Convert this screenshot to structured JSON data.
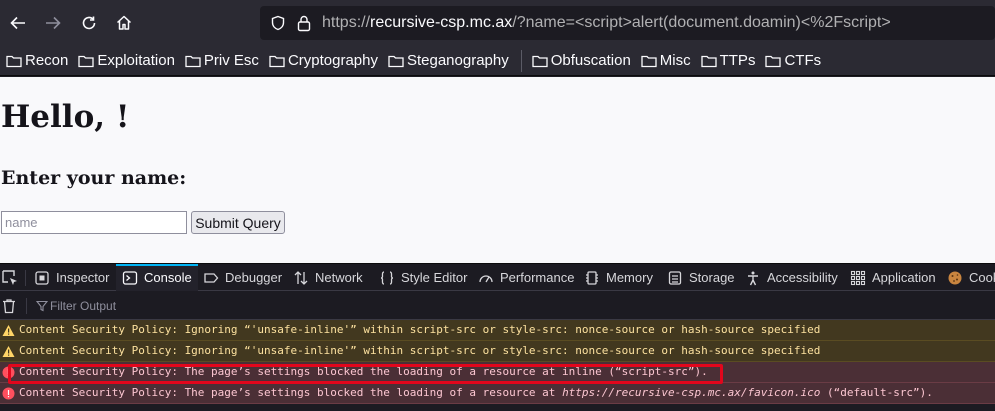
{
  "toolbar": {
    "back_icon": "back-arrow-icon",
    "forward_icon": "forward-arrow-icon",
    "reload_icon": "reload-icon",
    "home_icon": "home-icon",
    "url_prefix": "https://",
    "url_host": "recursive-csp.mc.ax",
    "url_rest": "/?name=<script>alert(document.doamin)<%2Fscript>"
  },
  "bookmarks": {
    "items": [
      {
        "label": "Recon"
      },
      {
        "label": "Exploitation"
      },
      {
        "label": "Priv Esc"
      },
      {
        "label": "Cryptography"
      },
      {
        "label": "Steganography"
      },
      {
        "label": "Obfuscation"
      },
      {
        "label": "Misc"
      },
      {
        "label": "TTPs"
      },
      {
        "label": "CTFs"
      }
    ]
  },
  "page": {
    "heading": "Hello, !",
    "subheading": "Enter your name:",
    "name_placeholder": "name",
    "name_value": "",
    "submit_label": "Submit Query"
  },
  "devtools": {
    "tabs": [
      {
        "label": "Inspector",
        "icon": "inspector-icon"
      },
      {
        "label": "Console",
        "icon": "console-icon",
        "selected": true
      },
      {
        "label": "Debugger",
        "icon": "debugger-icon"
      },
      {
        "label": "Network",
        "icon": "network-icon"
      },
      {
        "label": "Style Editor",
        "icon": "style-editor-icon"
      },
      {
        "label": "Performance",
        "icon": "performance-icon"
      },
      {
        "label": "Memory",
        "icon": "memory-icon"
      },
      {
        "label": "Storage",
        "icon": "storage-icon"
      },
      {
        "label": "Accessibility",
        "icon": "accessibility-icon"
      },
      {
        "label": "Application",
        "icon": "application-icon"
      },
      {
        "label": "Cook",
        "icon": "cookie-icon"
      }
    ],
    "filter_placeholder": "Filter Output",
    "messages": [
      {
        "level": "warning",
        "text": "Content Security Policy: Ignoring “'unsafe-inline'” within script-src or style-src: nonce-source or hash-source specified"
      },
      {
        "level": "warning",
        "text": "Content Security Policy: Ignoring “'unsafe-inline'” within script-src or style-src: nonce-source or hash-source specified"
      },
      {
        "level": "error",
        "text": "Content Security Policy: The page’s settings blocked the loading of a resource at inline (“script-src”)."
      },
      {
        "level": "error",
        "text_before": "Content Security Policy: The page’s settings blocked the loading of a resource at ",
        "text_url": "https://recursive-csp.mc.ax/favicon.ico",
        "text_after": " (“default-src”)."
      }
    ]
  },
  "colors": {
    "accent": "#00b3f4",
    "highlight": "#e2061c",
    "warning_bg": "#42381f",
    "error_bg": "#4b2f36"
  }
}
